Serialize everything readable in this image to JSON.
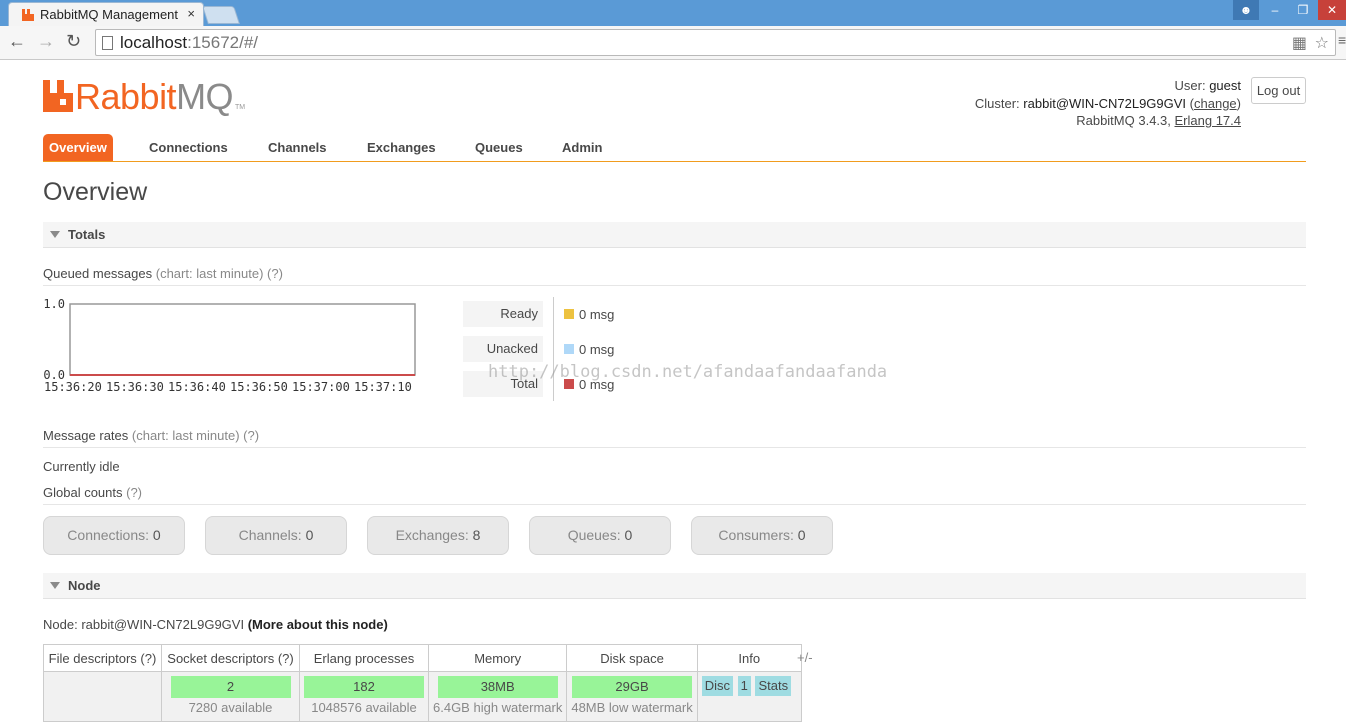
{
  "browser": {
    "tab_title": "RabbitMQ Management",
    "tab_close": "×",
    "url_host": "localhost",
    "url_rest": ":15672/#/",
    "icons": [
      "back-icon",
      "forward-icon",
      "reload-icon",
      "page-icon",
      "translate-icon",
      "star-icon",
      "menu-icon",
      "user-icon",
      "minimize-icon",
      "maximize-icon",
      "close-icon"
    ]
  },
  "logo": {
    "rabbit": "Rabbit",
    "mq": "MQ",
    "tm": "TM"
  },
  "user": {
    "user_label": "User:",
    "user_value": "guest",
    "cluster_label": "Cluster:",
    "cluster_value": "rabbit@WIN-CN72L9G9GVI",
    "cluster_change": "change",
    "version": "RabbitMQ 3.4.3,",
    "erlang": "Erlang 17.4",
    "logout": "Log out"
  },
  "nav": {
    "items": [
      {
        "label": "Overview",
        "active": true
      },
      {
        "label": "Connections"
      },
      {
        "label": "Channels"
      },
      {
        "label": "Exchanges"
      },
      {
        "label": "Queues"
      },
      {
        "label": "Admin"
      }
    ]
  },
  "page_title": "Overview",
  "totals": {
    "header": "Totals",
    "queued_label": "Queued messages",
    "queued_hint": "(chart: last minute) (?)",
    "legend": [
      {
        "label": "Ready",
        "value": "0 msg",
        "color": "#edc240"
      },
      {
        "label": "Unacked",
        "value": "0 msg",
        "color": "#afd8f8"
      },
      {
        "label": "Total",
        "value": "0 msg",
        "color": "#cb4b4b"
      }
    ],
    "rates_label": "Message rates",
    "rates_hint": "(chart: last minute) (?)",
    "idle": "Currently idle",
    "global_label": "Global counts",
    "global_hint": "(?)",
    "counts": [
      {
        "label": "Connections:",
        "value": "0"
      },
      {
        "label": "Channels:",
        "value": "0"
      },
      {
        "label": "Exchanges:",
        "value": "8"
      },
      {
        "label": "Queues:",
        "value": "0"
      },
      {
        "label": "Consumers:",
        "value": "0"
      }
    ]
  },
  "chart_data": {
    "type": "line",
    "x": [
      "15:36:20",
      "15:36:30",
      "15:36:40",
      "15:36:50",
      "15:37:00",
      "15:37:10"
    ],
    "series": [
      {
        "name": "Ready",
        "values": [
          0,
          0,
          0,
          0,
          0,
          0
        ],
        "color": "#edc240"
      },
      {
        "name": "Unacked",
        "values": [
          0,
          0,
          0,
          0,
          0,
          0
        ],
        "color": "#afd8f8"
      },
      {
        "name": "Total",
        "values": [
          0,
          0,
          0,
          0,
          0,
          0
        ],
        "color": "#cb4b4b"
      }
    ],
    "yticks": [
      "1.0",
      "0.0"
    ],
    "ylim": [
      0,
      1
    ],
    "title": "",
    "xlabel": "",
    "ylabel": ""
  },
  "watermark": "http://blog.csdn.net/afandaafandaafanda",
  "node": {
    "header": "Node",
    "node_label": "Node:",
    "node_value": "rabbit@WIN-CN72L9G9GVI",
    "more": "(More about this node)",
    "columns": [
      "File descriptors (?)",
      "Socket descriptors (?)",
      "Erlang processes",
      "Memory",
      "Disk space",
      "Info"
    ],
    "row": {
      "file_descriptors": "",
      "socket_value": "2",
      "socket_sub": "7280 available",
      "erlang_value": "182",
      "erlang_sub": "1048576 available",
      "memory_value": "38MB",
      "memory_sub": "6.4GB high watermark",
      "disk_value": "29GB",
      "disk_sub": "48MB low watermark",
      "info_tags": [
        "Disc",
        "1",
        "Stats"
      ]
    },
    "plusminus": "+/-"
  }
}
